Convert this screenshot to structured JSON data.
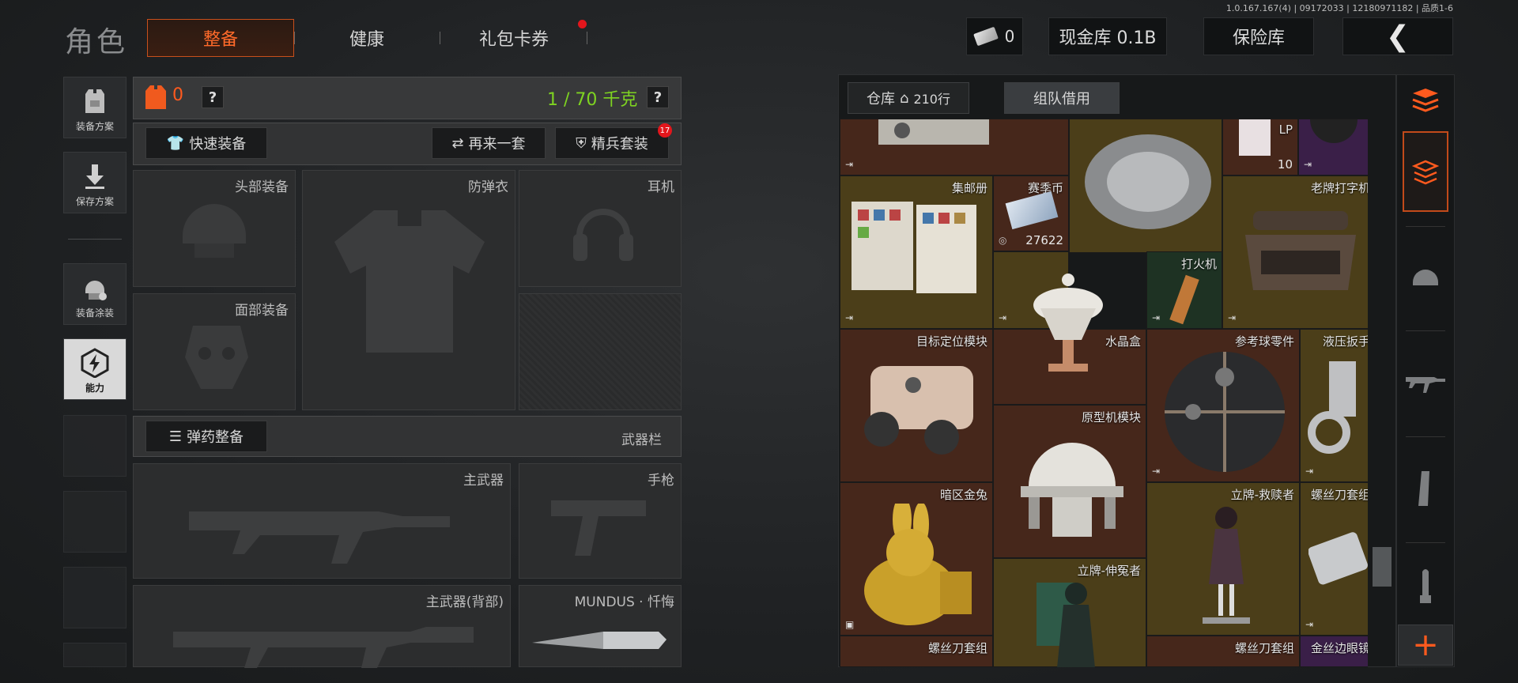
{
  "version": "1.0.167.167(4) | 09172033 | 12180971182 | 品质1-6",
  "header": {
    "title": "角色",
    "tabs": [
      {
        "label": "整备",
        "active": true
      },
      {
        "label": "健康",
        "active": false
      },
      {
        "label": "礼包卡券",
        "active": false,
        "notify": true
      }
    ],
    "currency_count": "0",
    "cash_vault": "现金库 0.1B",
    "insurance": "保险库"
  },
  "left_nav": [
    {
      "label": "装备方案",
      "icon": "vest-icon"
    },
    {
      "label": "保存方案",
      "icon": "download-icon"
    },
    {
      "label": "装备涂装",
      "icon": "helmet-paint-icon"
    },
    {
      "label": "能力",
      "icon": "ability-icon",
      "active": true
    }
  ],
  "equip": {
    "armor_count": "0",
    "weight": "1 / 70 千克",
    "quick_equip": "快速装备",
    "again": "再来一套",
    "elite": "精兵套装",
    "elite_badge": "17",
    "slots": {
      "head": "头部装备",
      "armor": "防弹衣",
      "earphone": "耳机",
      "face": "面部装备"
    },
    "ammo_equip": "弹药整备",
    "weapon_bar": "武器栏",
    "weapons": {
      "primary": "主武器",
      "pistol": "手枪",
      "primary_back": "主武器(背部)",
      "melee": "MUNDUS · 忏悔"
    }
  },
  "warehouse": {
    "tab_label": "仓库",
    "rows": "210行",
    "team_borrow": "组队借用",
    "items": [
      {
        "name": "集邮册"
      },
      {
        "name": "赛季币",
        "count": "27622"
      },
      {
        "name": "老牌打字机"
      },
      {
        "name": "水晶盒"
      },
      {
        "name": "打火机"
      },
      {
        "name": "目标定位模块"
      },
      {
        "name": "参考球零件"
      },
      {
        "name": "液压扳手"
      },
      {
        "name": "原型机模块"
      },
      {
        "name": "暗区金兔"
      },
      {
        "name": "立牌-救赎者"
      },
      {
        "name": "螺丝刀套组"
      },
      {
        "name": "立牌-伸冤者"
      },
      {
        "name": "螺丝刀套组"
      },
      {
        "name": "螺丝刀套组"
      },
      {
        "name": "金丝边眼镜"
      },
      {
        "name": "LP",
        "count": "10"
      }
    ]
  },
  "colors": {
    "accent": "#ff6a2a",
    "weight_green": "#7ed321",
    "notify_red": "#e3161c"
  }
}
